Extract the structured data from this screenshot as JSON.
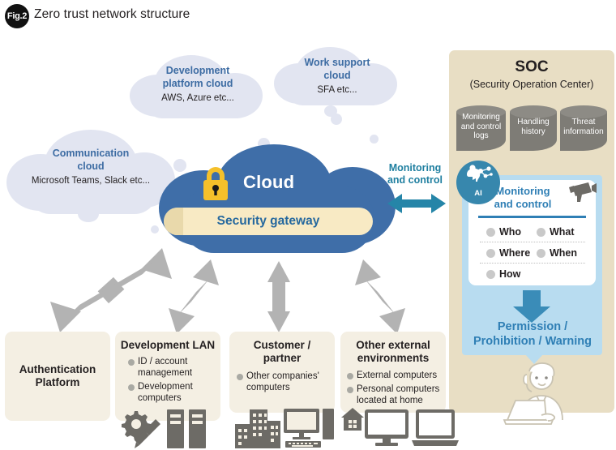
{
  "figure": {
    "badge": "Fig.2",
    "title": "Zero trust network structure"
  },
  "clouds": [
    {
      "name": "development-platform-cloud",
      "title": "Development\nplatform cloud",
      "title_line1": "Development",
      "title_line2": "platform cloud",
      "subtitle": "AWS, Azure etc..."
    },
    {
      "name": "work-support-cloud",
      "title_line1": "Work support",
      "title_line2": "cloud",
      "subtitle": "SFA etc..."
    },
    {
      "name": "communication-cloud",
      "title_line1": "Communication",
      "title_line2": "cloud",
      "subtitle": "Microsoft Teams, Slack etc..."
    }
  ],
  "main_cloud": {
    "label": "Cloud",
    "gateway_label": "Security gateway",
    "lock_icon": "padlock-icon"
  },
  "monitoring_link": {
    "line1": "Monitoring",
    "line2": "and control",
    "arrow_icon": "double-arrow-horizontal-icon",
    "color": "#1f7fa0"
  },
  "soc": {
    "title": "SOC",
    "subtitle": "(Security Operation Center)",
    "panel_color": "#e8dec4",
    "databases": [
      {
        "name": "monitoring-and-control-logs-db",
        "label": "Monitoring and control logs"
      },
      {
        "name": "handling-history-db",
        "label": "Handling history"
      },
      {
        "name": "threat-information-db",
        "label": "Threat information"
      }
    ],
    "ai_badge": {
      "label": "AI",
      "icon": "ai-brain-network-icon",
      "color": "#3787ad"
    },
    "camera_icon": "security-camera-icon",
    "card": {
      "title_line1": "Monitoring",
      "title_line2": "and control",
      "items": [
        "Who",
        "What",
        "Where",
        "When",
        "How"
      ]
    },
    "down_arrow_icon": "arrow-down-icon",
    "outcome_line1": "Permission /",
    "outcome_line2": "Prohibition / Warning",
    "operator_icon": "support-operator-icon"
  },
  "bottom_boxes": [
    {
      "name": "authentication-platform",
      "title_line1": "Authentication",
      "title_line2": "Platform",
      "items": [],
      "icons": []
    },
    {
      "name": "development-lan",
      "title_line1": "Development LAN",
      "title_line2": "",
      "items": [
        "ID / account management",
        "Development computers"
      ],
      "icons": [
        "gear-screwdriver-icon",
        "server-rack-icon"
      ]
    },
    {
      "name": "customer-partner",
      "title_line1": "Customer /",
      "title_line2": "partner",
      "items": [
        "Other companies' computers"
      ],
      "icons": [
        "office-buildings-icon",
        "desktop-computer-icon"
      ]
    },
    {
      "name": "other-external-environments",
      "title_line1": "Other external",
      "title_line2": "environments",
      "items": [
        "External computers",
        "Personal computers located at home"
      ],
      "icons": [
        "home-icon",
        "monitor-icon",
        "laptop-icon"
      ]
    }
  ],
  "colors": {
    "cloud_blue": "#3f6ea8",
    "light_cloud": "#e2e5f1",
    "gateway_cream": "#f8eac4",
    "soc_tan": "#e8dec4",
    "panel_blue": "#b8dcf0",
    "accent_teal": "#2f7fb5",
    "box_cream": "#f4efe3",
    "arrow_gray": "#b3b3b3"
  }
}
